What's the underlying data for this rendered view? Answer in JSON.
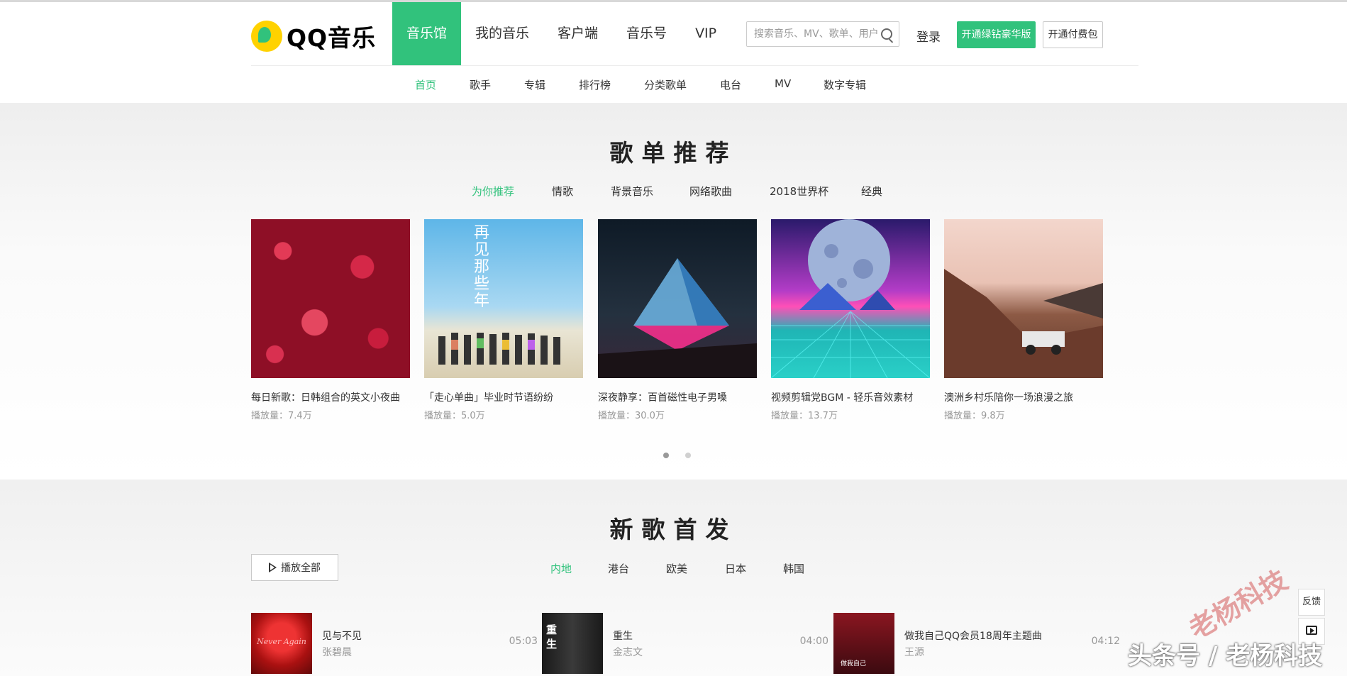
{
  "header": {
    "logo_text": "QQ音乐",
    "nav": [
      "音乐馆",
      "我的音乐",
      "客户端",
      "音乐号",
      "VIP"
    ],
    "search_placeholder": "搜索音乐、MV、歌单、用户",
    "login": "登录",
    "green_button": "开通绿钻豪华版",
    "paid_button": "开通付费包"
  },
  "subnav": [
    "首页",
    "歌手",
    "专辑",
    "排行榜",
    "分类歌单",
    "电台",
    "MV",
    "数字专辑"
  ],
  "playlists": {
    "title": "歌单推荐",
    "tabs": [
      "为你推荐",
      "情歌",
      "背景音乐",
      "网络歌曲",
      "2018世界杯",
      "经典"
    ],
    "items": [
      {
        "title": "每日新歌：日韩组合的英文小夜曲",
        "plays": "播放量：7.4万"
      },
      {
        "title": "「走心单曲」毕业时节语纷纷",
        "plays": "播放量：5.0万"
      },
      {
        "title": "深夜静享：百首磁性电子男嗓",
        "plays": "播放量：30.0万"
      },
      {
        "title": "视频剪辑党BGM - 轻乐音效素材",
        "plays": "播放量：13.7万"
      },
      {
        "title": "澳洲乡村乐陪你一场浪漫之旅",
        "plays": "播放量：9.8万"
      }
    ],
    "cover2_text": "再见那些年"
  },
  "new_songs": {
    "title": "新歌首发",
    "play_all": "播放全部",
    "tabs": [
      "内地",
      "港台",
      "欧美",
      "日本",
      "韩国"
    ],
    "songs": [
      {
        "name": "见与不见",
        "artist": "张碧晨",
        "duration": "05:03",
        "thumb_text": "Never Again"
      },
      {
        "name": "重生",
        "artist": "金志文",
        "duration": "04:00",
        "thumb_text": "重生"
      },
      {
        "name": "做我自己QQ会员18周年主题曲",
        "artist": "王源",
        "duration": "04:12",
        "thumb_text": "做我自己"
      }
    ]
  },
  "side": {
    "feedback": "反馈"
  },
  "watermark": {
    "seal": "老杨科技",
    "credit": "头条号 / 老杨科技"
  },
  "colors": {
    "accent": "#31c27c"
  }
}
